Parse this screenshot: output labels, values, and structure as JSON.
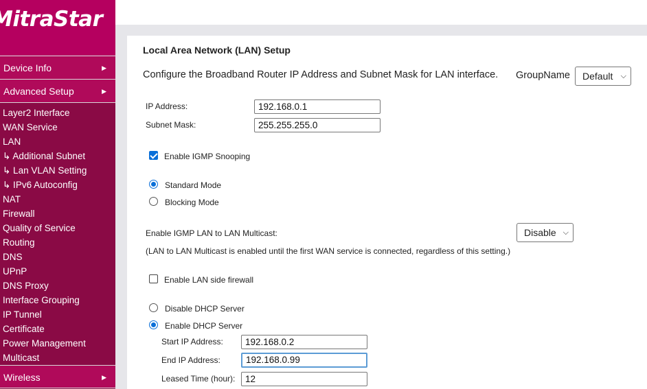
{
  "brand": {
    "logo_text": "MitraStar"
  },
  "sidebar": {
    "device_info": "Device Info",
    "advanced_setup": "Advanced Setup",
    "wireless": "Wireless",
    "items": [
      "Layer2 Interface",
      "WAN Service",
      "LAN",
      "↳ Additional Subnet",
      "↳ Lan VLAN Setting",
      "↳ IPv6 Autoconfig",
      "NAT",
      "Firewall",
      "Quality of Service",
      "Routing",
      "DNS",
      "UPnP",
      "DNS Proxy",
      "Interface Grouping",
      "IP Tunnel",
      "Certificate",
      "Power Management",
      "Multicast"
    ]
  },
  "page": {
    "title": "Local Area Network (LAN) Setup",
    "description": "Configure the Broadband Router IP Address and Subnet Mask for LAN interface.",
    "group_name_label": "GroupName",
    "group_name_value": "Default",
    "ip_address_label": "IP Address:",
    "ip_address_value": "192.168.0.1",
    "subnet_mask_label": "Subnet Mask:",
    "subnet_mask_value": "255.255.255.0",
    "igmp_snooping_label": "Enable IGMP Snooping",
    "igmp_snooping_checked": true,
    "standard_mode_label": "Standard Mode",
    "blocking_mode_label": "Blocking Mode",
    "igmp_mode_selected": "Standard Mode",
    "lan_multicast_label": "Enable IGMP LAN to LAN Multicast:",
    "lan_multicast_value": "Disable",
    "lan_multicast_note": "(LAN to LAN Multicast is enabled until the first WAN service is connected, regardless of this setting.)",
    "lan_firewall_label": "Enable LAN side firewall",
    "lan_firewall_checked": false,
    "disable_dhcp_label": "Disable DHCP Server",
    "enable_dhcp_label": "Enable DHCP Server",
    "dhcp_selected": "Enable DHCP Server",
    "start_ip_label": "Start IP Address:",
    "start_ip_value": "192.168.0.2",
    "end_ip_label": "End IP Address:",
    "end_ip_value": "192.168.0.99",
    "lease_time_label": "Leased Time (hour):",
    "lease_time_value": "12"
  },
  "colors": {
    "sidebar_bg": "#8a0a45",
    "menu_bg": "#b00a5a",
    "logo_bg": "#b5005f",
    "accent": "#0a6fd8"
  }
}
